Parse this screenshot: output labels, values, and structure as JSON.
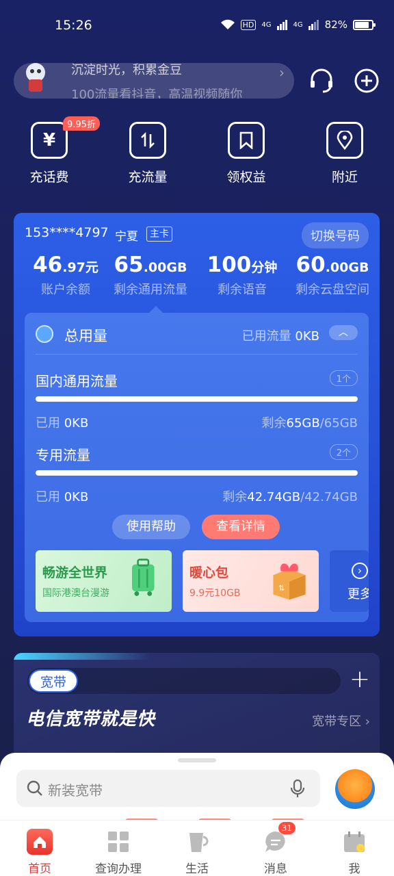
{
  "status": {
    "time": "15:26",
    "hd": "HD",
    "net1": "4G",
    "net2": "4G",
    "battery": "82%"
  },
  "banner": {
    "line1": "沉淀时光，积累金豆",
    "line2": "100流量看抖音，高温视频随你"
  },
  "quick_actions": [
    {
      "label": "充话费",
      "icon": "yen-icon",
      "glyph": "¥",
      "badge": "9.95折"
    },
    {
      "label": "充流量",
      "icon": "data-transfer-icon",
      "glyph": "⇅",
      "badge": ""
    },
    {
      "label": "领权益",
      "icon": "bookmark-icon",
      "glyph": "🔖",
      "badge": ""
    },
    {
      "label": "附近",
      "icon": "location-pin-icon",
      "glyph": "⌖",
      "badge": ""
    }
  ],
  "account": {
    "phone": "153****4797",
    "region": "宁夏",
    "card_type": "主卡",
    "switch_label": "切换号码",
    "stats": [
      {
        "big": "46",
        "small": ".97元",
        "label": "账户余额"
      },
      {
        "big": "65",
        "small": ".00GB",
        "label": "剩余通用流量"
      },
      {
        "big": "100",
        "small": "分钟",
        "label": "剩余语音"
      },
      {
        "big": "60",
        "small": ".00GB",
        "label": "剩余云盘空间"
      }
    ]
  },
  "usage": {
    "title": "总用量",
    "used_label": "已用流量",
    "used_value": "0KB",
    "toggle_glyph": "︿",
    "rows": [
      {
        "title": "国内通用流量",
        "count": "1个",
        "used_label": "已用",
        "used_value": "0KB",
        "remain_label": "剩余",
        "remain_value": "65GB",
        "total": "/65GB",
        "remaining_fraction": 1.0
      },
      {
        "title": "专用流量",
        "count": "2个",
        "used_label": "已用",
        "used_value": "0KB",
        "remain_label": "剩余",
        "remain_value": "42.74GB",
        "total": "/42.74GB",
        "remaining_fraction": 1.0
      }
    ],
    "help_label": "使用帮助",
    "detail_label": "查看详情",
    "promos": [
      {
        "title": "畅游全世界",
        "subtitle": "国际港澳台漫游"
      },
      {
        "title": "暖心包",
        "subtitle": "9.9元10GB"
      },
      {
        "title": "更多",
        "subtitle": ""
      }
    ]
  },
  "broadband": {
    "tab": "宽带",
    "plus": "+",
    "title": "电信宽带就是快",
    "link": "宽带专区"
  },
  "search": {
    "placeholder": "新装宽带"
  },
  "tabbar": [
    {
      "label": "首页",
      "active": true,
      "badge": ""
    },
    {
      "label": "查询办理",
      "active": false,
      "badge": ""
    },
    {
      "label": "生活",
      "active": false,
      "badge": ""
    },
    {
      "label": "消息",
      "active": false,
      "badge": "31"
    },
    {
      "label": "我",
      "active": false,
      "badge": ""
    }
  ],
  "colors": {
    "accent_red": "#ff5e57",
    "brand_blue": "#2d5fe6",
    "detail_btn": "#ff7a72"
  }
}
